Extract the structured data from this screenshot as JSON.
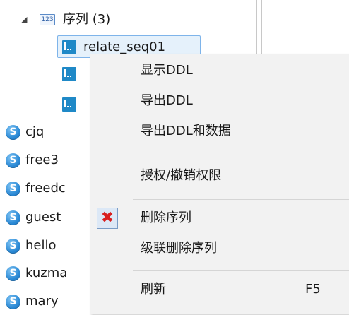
{
  "tree": {
    "sequence_folder": {
      "expander": "◢",
      "badge": "123",
      "label": "序列 (3)"
    },
    "sequences": [
      "relate_seq01",
      "",
      ""
    ],
    "schemas": [
      {
        "icon": "S",
        "label": "cjq"
      },
      {
        "icon": "S",
        "label": "free3"
      },
      {
        "icon": "S",
        "label": "freedc"
      },
      {
        "icon": "S",
        "label": "guest"
      },
      {
        "icon": "S",
        "label": "hello"
      },
      {
        "icon": "S",
        "label": "kuzma"
      },
      {
        "icon": "S",
        "label": "mary"
      }
    ]
  },
  "context_menu": {
    "items": [
      {
        "label": "显示DDL"
      },
      {
        "label": "导出DDL"
      },
      {
        "label": "导出DDL和数据"
      },
      {
        "label": "授权/撤销权限"
      },
      {
        "label": "删除序列",
        "icon": "delete-icon",
        "icon_glyph": "✖",
        "icon_color": "#d91f1f"
      },
      {
        "label": "级联删除序列"
      },
      {
        "label": "刷新",
        "shortcut": "F5"
      }
    ]
  }
}
